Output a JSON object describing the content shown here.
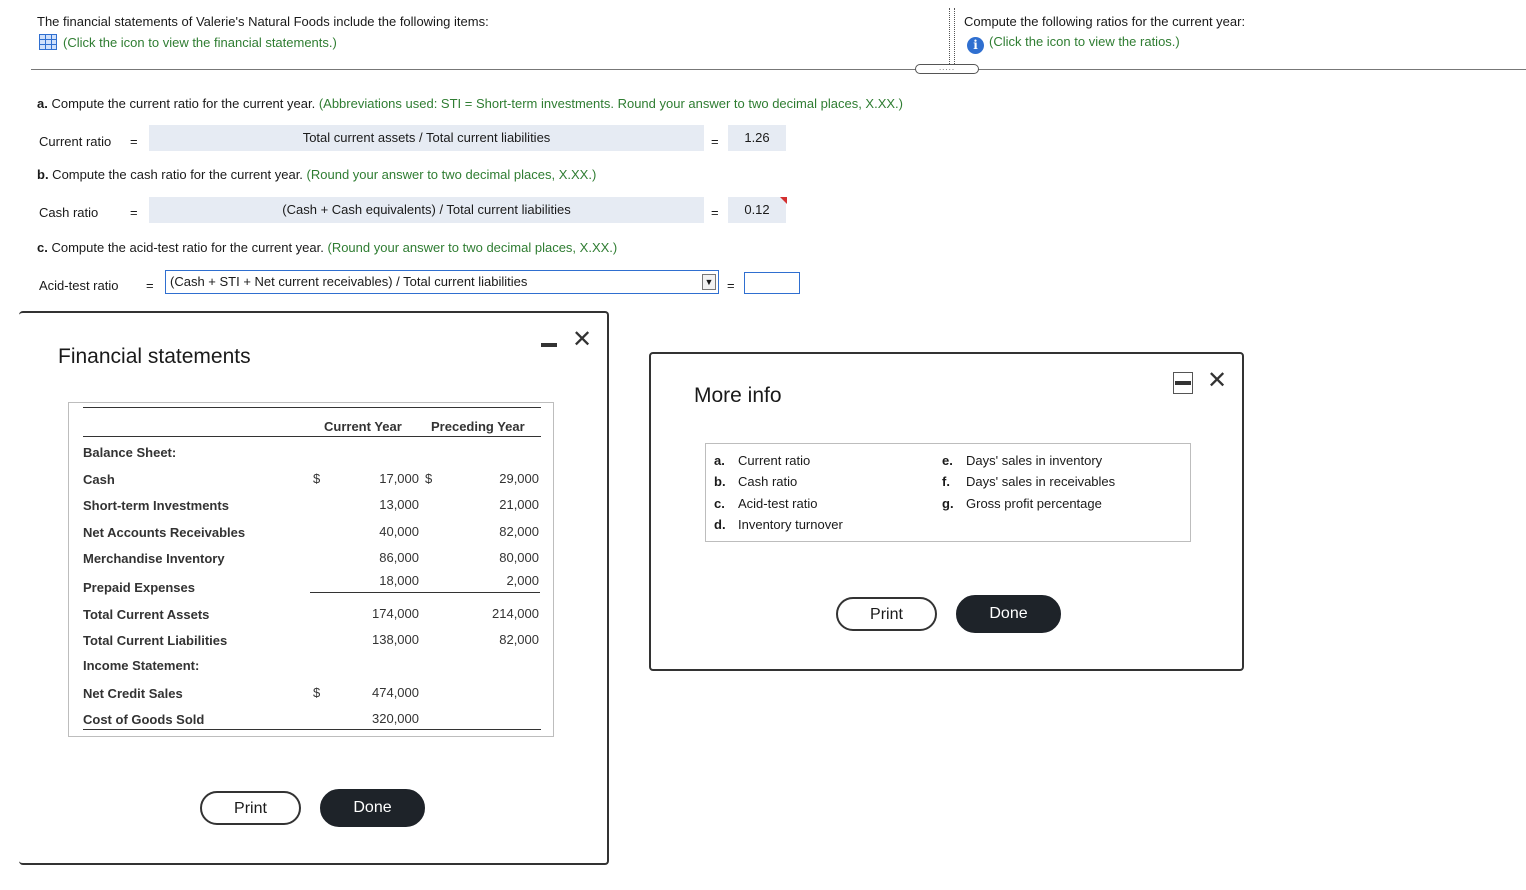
{
  "intro": {
    "statement_text": "The financial statements of Valerie's Natural Foods include the following items:",
    "statement_link": "(Click the icon to view the financial statements.)",
    "ratios_text": "Compute the following ratios for the current year:",
    "ratios_link": "(Click the icon to view the ratios.)"
  },
  "questions": {
    "a": {
      "prefix": "a.",
      "text": " Compute the current ratio for the current year. ",
      "hint": "(Abbreviations used: STI = Short-term investments. Round your answer to two decimal places, X.XX.)",
      "label": "Current ratio",
      "eq": "=",
      "formula": "Total current assets / Total current liabilities",
      "eq2": "=",
      "answer": "1.26"
    },
    "b": {
      "prefix": "b.",
      "text": " Compute the cash ratio for the current year. ",
      "hint": "(Round your answer to two decimal places, X.XX.)",
      "label": "Cash ratio",
      "eq": "=",
      "formula": "(Cash + Cash equivalents) / Total current liabilities",
      "eq2": "=",
      "answer": "0.12"
    },
    "c": {
      "prefix": "c.",
      "text": " Compute the acid-test ratio for the current year. ",
      "hint": "(Round your answer to two decimal places, X.XX.)",
      "label": "Acid-test ratio",
      "eq": "=",
      "formula_selected": "(Cash + STI + Net current receivables) / Total current liabilities",
      "eq2": "=",
      "answer": ""
    }
  },
  "fs_modal": {
    "title": "Financial statements",
    "col_current": "Current Year",
    "col_preceding": "Preceding Year",
    "section_balance": "Balance Sheet:",
    "rows": [
      {
        "label": "Cash",
        "cur": "17,000",
        "prev": "29,000"
      },
      {
        "label": "Short-term Investments",
        "cur": "13,000",
        "prev": "21,000"
      },
      {
        "label": "Net Accounts Receivables",
        "cur": "40,000",
        "prev": "82,000"
      },
      {
        "label": "Merchandise Inventory",
        "cur": "86,000",
        "prev": "80,000"
      },
      {
        "label": "Prepaid Expenses",
        "cur": "18,000",
        "prev": "2,000"
      },
      {
        "label": "Total Current Assets",
        "cur": "174,000",
        "prev": "214,000"
      },
      {
        "label": "Total Current Liabilities",
        "cur": "138,000",
        "prev": "82,000"
      }
    ],
    "section_income": "Income Statement:",
    "income_rows": [
      {
        "label": "Net Credit Sales",
        "cur": "474,000"
      },
      {
        "label": "Cost of Goods Sold",
        "cur": "320,000"
      }
    ],
    "dollar": "$",
    "cash_dollar_prev": "$",
    "print_label": "Print",
    "done_label": "Done"
  },
  "info_modal": {
    "title": "More info",
    "items_left": [
      {
        "key": "a.",
        "text": "Current ratio"
      },
      {
        "key": "b.",
        "text": "Cash ratio"
      },
      {
        "key": "c.",
        "text": "Acid-test ratio"
      },
      {
        "key": "d.",
        "text": "Inventory turnover"
      }
    ],
    "items_right": [
      {
        "key": "e.",
        "text": "Days' sales in inventory"
      },
      {
        "key": "f.",
        "text": "Days' sales in receivables"
      },
      {
        "key": "g.",
        "text": "Gross profit percentage"
      }
    ],
    "print_label": "Print",
    "done_label": "Done"
  },
  "icons": {
    "statements": "table-grid-icon",
    "ratios": "info-icon",
    "minimize": "minimize-icon",
    "close": "close-icon",
    "dropdown": "dropdown-arrow-icon"
  },
  "colors": {
    "hint_green": "#2f7d32",
    "link_blue": "#2f6fd0",
    "formula_bg": "#e6ebf3",
    "done_bg": "#1e2329"
  }
}
